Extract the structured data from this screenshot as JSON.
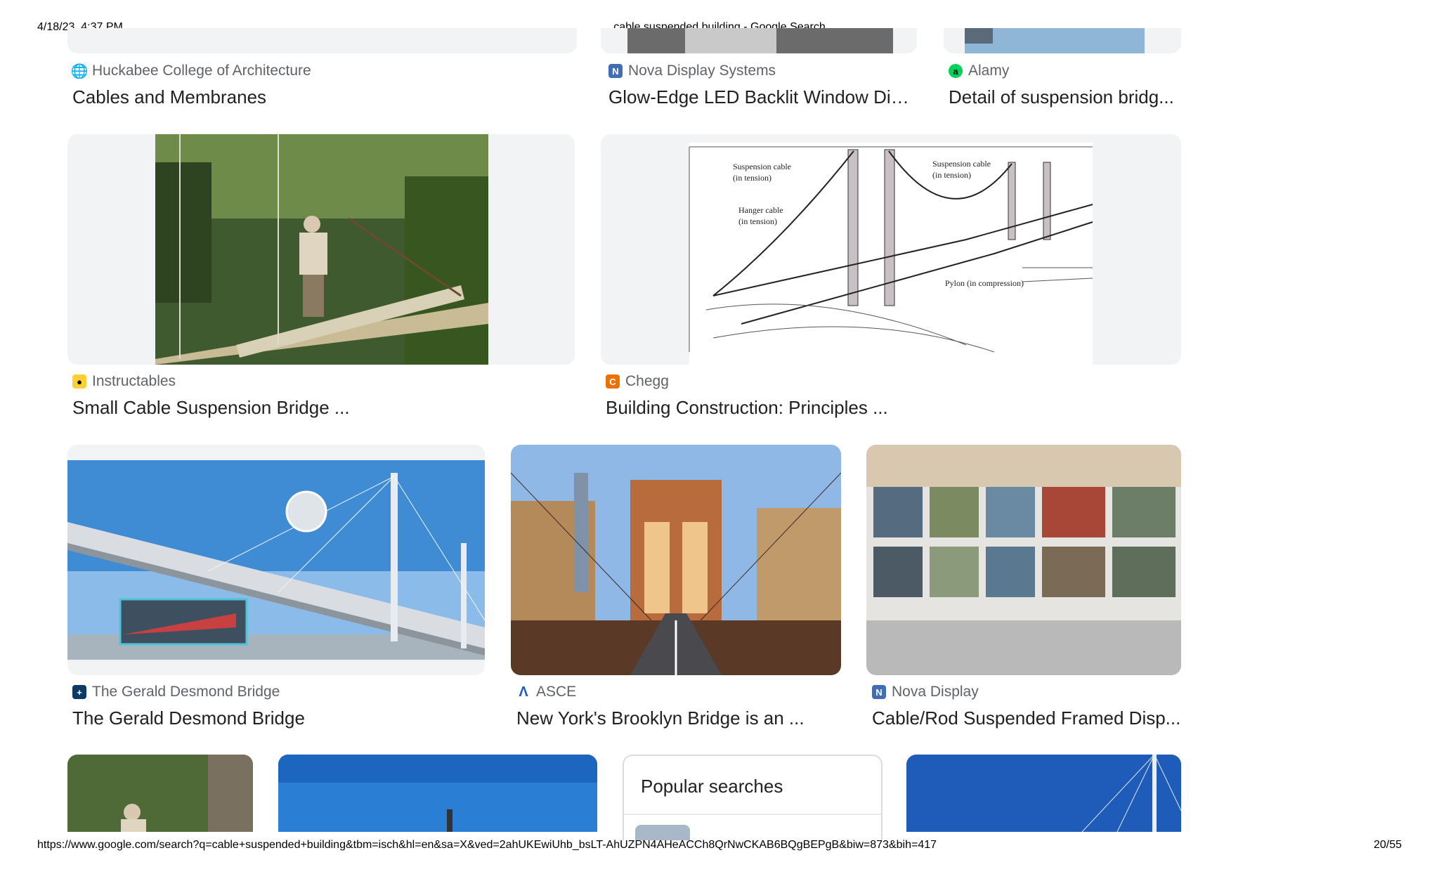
{
  "print_header": {
    "datetime": "4/18/23, 4:37 PM",
    "page_title": "cable suspended building - Google Search"
  },
  "print_footer": {
    "url": "https://www.google.com/search?q=cable+suspended+building&tbm=isch&hl=en&sa=X&ved=2ahUKEwiUhb_bsLT-AhUZPN4AHeACCh8QrNwCKAB6BQgBEPgB&biw=873&bih=417",
    "page_counter": "20/55"
  },
  "results": [
    {
      "source": "Huckabee College of Architecture",
      "title": "Cables and Membranes",
      "icon": "globe-icon"
    },
    {
      "source": "Nova Display Systems",
      "title": "Glow-Edge LED Backlit Window Dis...",
      "icon": "nova-display-favicon"
    },
    {
      "source": "Alamy",
      "title": "Detail of suspension bridg...",
      "icon": "alamy-favicon"
    },
    {
      "source": "Instructables",
      "title": "Small Cable Suspension Bridge ...",
      "icon": "instructables-favicon"
    },
    {
      "source": "Chegg",
      "title": "Building Construction: Principles ...",
      "icon": "chegg-favicon"
    },
    {
      "source": "The Gerald Desmond Bridge",
      "title": "The Gerald Desmond Bridge",
      "icon": "gerald-desmond-favicon"
    },
    {
      "source": "ASCE",
      "title": "New York's Brooklyn Bridge is an ...",
      "icon": "asce-favicon"
    },
    {
      "source": "Nova Display",
      "title": "Cable/Rod Suspended Framed Disp...",
      "icon": "nova-display-favicon"
    }
  ],
  "diagram_labels": {
    "suspension_cable_left": "Suspension cable",
    "in_tension_1": "(in tension)",
    "suspension_cable_right": "Suspension cable",
    "in_tension_2": "(in tension)",
    "hanger_cable": "Hanger cable",
    "in_tension_3": "(in tension)",
    "pylon": "Pylon (in compression)"
  },
  "popular_searches": {
    "title": "Popular searches"
  },
  "colors": {
    "chegg": "#eb7100",
    "nova": "#3f6eb5",
    "alamy": "#00d35a",
    "asce": "#1f5fbf"
  }
}
